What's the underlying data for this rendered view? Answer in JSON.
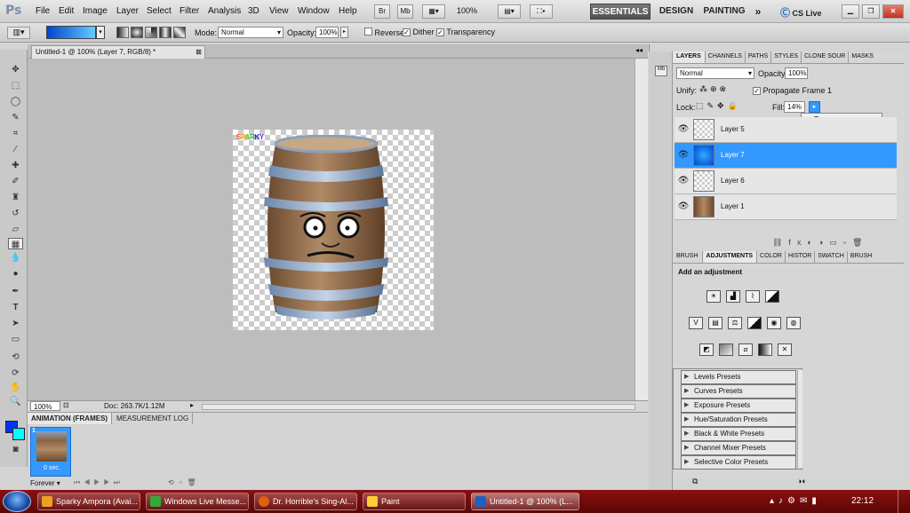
{
  "app": {
    "logo": "Ps"
  },
  "menu": [
    "File",
    "Edit",
    "Image",
    "Layer",
    "Select",
    "Filter",
    "Analysis",
    "3D",
    "View",
    "Window",
    "Help"
  ],
  "menubar": {
    "br": "Br",
    "mb": "Mb",
    "zoom": "100%",
    "workspaces": [
      "ESSENTIALS",
      "DESIGN",
      "PAINTING"
    ],
    "more": "»",
    "cs_live": "CS Live"
  },
  "options": {
    "mode_label": "Mode:",
    "mode_value": "Normal",
    "opacity_label": "Opacity:",
    "opacity_value": "100%",
    "reverse": "Reverse",
    "dither": "Dither",
    "transparency": "Transparency"
  },
  "document": {
    "tab_title": "Untitled-1 @ 100% (Layer 7, RGB/8) *",
    "watermark": "SPARKY",
    "zoom": "100%",
    "doc_size": "Doc: 263.7K/1.12M"
  },
  "animation": {
    "tabs": [
      "ANIMATION (FRAMES)",
      "MEASUREMENT LOG"
    ],
    "frame_number": "1",
    "frame_delay": "0 sec.",
    "loop": "Forever"
  },
  "layers_panel": {
    "tabs": [
      "LAYERS",
      "CHANNELS",
      "PATHS",
      "STYLES",
      "CLONE SOUR",
      "MASKS"
    ],
    "blend_mode": "Normal",
    "opacity_label": "Opacity:",
    "opacity_value": "100%",
    "unify_label": "Unify:",
    "propagate": "Propagate Frame 1",
    "lock_label": "Lock:",
    "fill_label": "Fill:",
    "fill_value": "14%",
    "layers": [
      {
        "name": "Layer 5"
      },
      {
        "name": "Layer 7"
      },
      {
        "name": "Layer 6"
      },
      {
        "name": "Layer 1"
      }
    ]
  },
  "adjustments_panel": {
    "tabs": [
      "BRUSH",
      "ADJUSTMENTS",
      "COLOR",
      "HISTOR",
      "SWATCH",
      "BRUSH"
    ],
    "heading": "Add an adjustment",
    "presets": [
      "Levels Presets",
      "Curves Presets",
      "Exposure Presets",
      "Hue/Saturation Presets",
      "Black & White Presets",
      "Channel Mixer Presets",
      "Selective Color Presets"
    ]
  },
  "taskbar": {
    "tasks": [
      {
        "label": "Sparky Ampora (Avai...",
        "color": "#f0a020"
      },
      {
        "label": "Windows Live Messe...",
        "color": "#33aa33"
      },
      {
        "label": "Dr. Horrible's Sing-Al...",
        "color": "#e06010"
      },
      {
        "label": "Paint",
        "color": "#ffcc33"
      },
      {
        "label": "Untitled-1 @ 100% (L...",
        "color": "#2060c0"
      }
    ],
    "clock": "22:12"
  },
  "colors": {
    "accent": "#3399ff",
    "taskbar": "#6b0808",
    "gradient_start": "#0044cc",
    "gradient_end": "#66ccff"
  }
}
